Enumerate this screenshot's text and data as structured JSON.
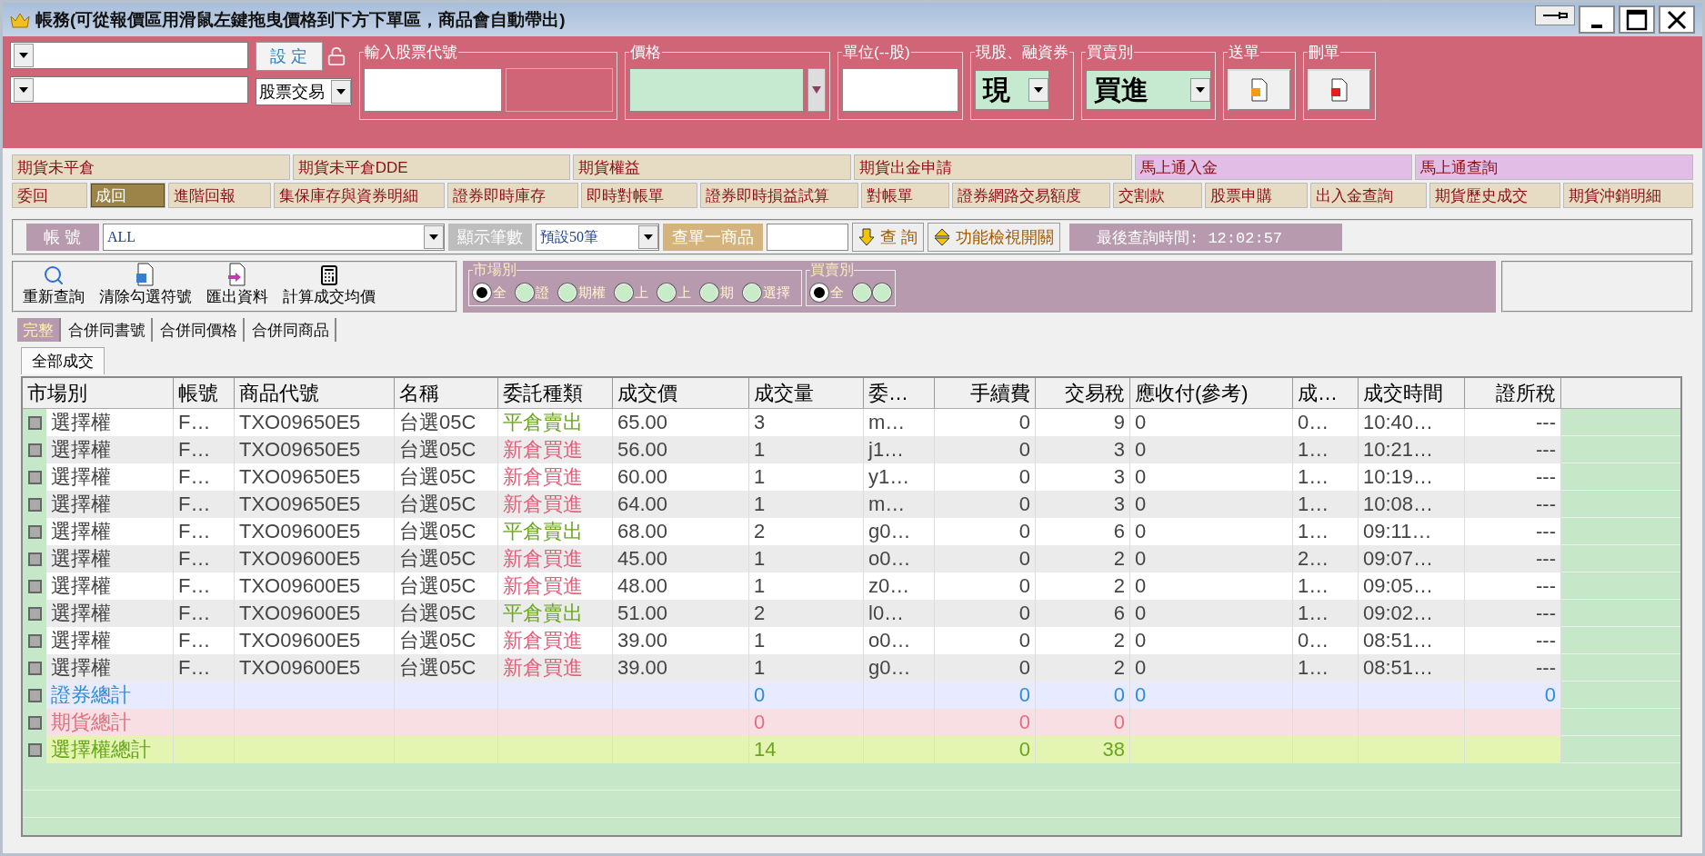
{
  "window": {
    "title": "帳務(可從報價區用滑鼠左鍵拖曳價格到下方下單區，商品會自動帶出)"
  },
  "order_panel": {
    "settings_button": "設 定",
    "trade_type": "股票交易",
    "stock_code_label": "輸入股票代號",
    "price_label": "價格",
    "unit_label": "單位(--股)",
    "cash_margin_label": "現股、融資券",
    "cash_margin": "現",
    "side_label": "買賣別",
    "side": "買進",
    "send_label": "送單",
    "delete_label": "刪單"
  },
  "tab_rows": [
    [
      {
        "label": "期貨未平倉",
        "color": "#e6dcc4",
        "selected": false
      },
      {
        "label": "期貨未平倉DDE",
        "color": "#e6dcc4",
        "selected": false
      },
      {
        "label": "期貨權益",
        "color": "#e6dcc4",
        "selected": false
      },
      {
        "label": "期貨出金申請",
        "color": "#e6dcc4",
        "selected": false
      },
      {
        "label": "馬上通入金",
        "color": "#e2bde6",
        "selected": false
      },
      {
        "label": "馬上通查詢",
        "color": "#e2bde6",
        "selected": false
      }
    ],
    [
      {
        "label": "委回",
        "color": "#e6dcc4",
        "selected": false
      },
      {
        "label": "成回",
        "color": "#9c8448",
        "selected": true
      },
      {
        "label": "進階回報",
        "color": "#e6dcc4",
        "selected": false
      },
      {
        "label": "集保庫存與資券明細",
        "color": "#e6dcc4",
        "selected": false
      },
      {
        "label": "證券即時庫存",
        "color": "#e6dcc4",
        "selected": false
      },
      {
        "label": "即時對帳單",
        "color": "#e6dcc4",
        "selected": false
      },
      {
        "label": "證券即時損益試算",
        "color": "#e6dcc4",
        "selected": false
      },
      {
        "label": "對帳單",
        "color": "#e6dcc4",
        "selected": false
      },
      {
        "label": "證券網路交易額度",
        "color": "#e6dcc4",
        "selected": false
      },
      {
        "label": "交割款",
        "color": "#e6dcc4",
        "selected": false
      },
      {
        "label": "股票申購",
        "color": "#e6dcc4",
        "selected": false
      },
      {
        "label": "出入金查詢",
        "color": "#e6dcc4",
        "selected": false
      },
      {
        "label": "期貨歷史成交",
        "color": "#e6dcc4",
        "selected": false
      },
      {
        "label": "期貨沖銷明細",
        "color": "#e6dcc4",
        "selected": false
      }
    ]
  ],
  "query_bar": {
    "account_label": "帳 號",
    "account": "ALL",
    "count_label": "顯示筆數",
    "count": "預設50筆",
    "product_label": "查單一商品",
    "query_button": "查 詢",
    "toggle_button": "功能檢視開關",
    "last_query": "最後查詢時間: 12:02:57"
  },
  "actions": [
    {
      "label": "重新查詢",
      "kind": "search"
    },
    {
      "label": "清除勾選符號",
      "kind": "clear"
    },
    {
      "label": "匯出資料",
      "kind": "export"
    },
    {
      "label": "計算成交均價",
      "kind": "calculator"
    }
  ],
  "market_filter": {
    "title": "市場別",
    "options": [
      {
        "label": "全",
        "selected": true
      },
      {
        "label": "證",
        "selected": false
      },
      {
        "label": "期權",
        "selected": false
      },
      {
        "label": "上",
        "selected": false
      },
      {
        "label": "上",
        "selected": false
      },
      {
        "label": "期",
        "selected": false
      },
      {
        "label": "選擇",
        "selected": false
      }
    ]
  },
  "side_filter": {
    "title": "買賣別",
    "options": [
      {
        "label": "全",
        "selected": true
      },
      {
        "selected": false
      },
      {
        "selected": false
      }
    ]
  },
  "view_tabs": [
    {
      "label": "完整",
      "selected": true
    },
    {
      "label": "合併同書號",
      "selected": false
    },
    {
      "label": "合併同價格",
      "selected": false
    },
    {
      "label": "合併同商品",
      "selected": false
    }
  ],
  "sub_tab": {
    "label": "全部成交"
  },
  "table": {
    "columns": [
      "市場別",
      "帳號",
      "商品代號",
      "名稱",
      "委託種類",
      "成交價",
      "成交量",
      "委…",
      "手續費",
      "交易稅",
      "應收付(參考)",
      "成…",
      "成交時間",
      "證所稅"
    ],
    "rows": [
      {
        "kind": "trade",
        "checked": false,
        "color": "#6aa51e",
        "cells": [
          "選擇權",
          "F…",
          "TXO09650E5",
          "台選05C",
          "平倉賣出",
          "65.00",
          "3",
          "m…",
          "0",
          "9",
          "0",
          "0…",
          "10:40…",
          "---"
        ]
      },
      {
        "kind": "trade",
        "checked": false,
        "color": "#e0607a",
        "cells": [
          "選擇權",
          "F…",
          "TXO09650E5",
          "台選05C",
          "新倉買進",
          "56.00",
          "1",
          "j1…",
          "0",
          "3",
          "0",
          "1…",
          "10:21…",
          "---"
        ]
      },
      {
        "kind": "trade",
        "checked": false,
        "color": "#e0607a",
        "cells": [
          "選擇權",
          "F…",
          "TXO09650E5",
          "台選05C",
          "新倉買進",
          "60.00",
          "1",
          "y1…",
          "0",
          "3",
          "0",
          "1…",
          "10:19…",
          "---"
        ]
      },
      {
        "kind": "trade",
        "checked": false,
        "color": "#e0607a",
        "cells": [
          "選擇權",
          "F…",
          "TXO09650E5",
          "台選05C",
          "新倉買進",
          "64.00",
          "1",
          "m…",
          "0",
          "3",
          "0",
          "1…",
          "10:08…",
          "---"
        ]
      },
      {
        "kind": "trade",
        "checked": false,
        "color": "#6aa51e",
        "cells": [
          "選擇權",
          "F…",
          "TXO09600E5",
          "台選05C",
          "平倉賣出",
          "68.00",
          "2",
          "g0…",
          "0",
          "6",
          "0",
          "1…",
          "09:11…",
          "---"
        ]
      },
      {
        "kind": "trade",
        "checked": false,
        "color": "#e0607a",
        "cells": [
          "選擇權",
          "F…",
          "TXO09600E5",
          "台選05C",
          "新倉買進",
          "45.00",
          "1",
          "o0…",
          "0",
          "2",
          "0",
          "2…",
          "09:07…",
          "---"
        ]
      },
      {
        "kind": "trade",
        "checked": false,
        "color": "#e0607a",
        "cells": [
          "選擇權",
          "F…",
          "TXO09600E5",
          "台選05C",
          "新倉買進",
          "48.00",
          "1",
          "z0…",
          "0",
          "2",
          "0",
          "1…",
          "09:05…",
          "---"
        ]
      },
      {
        "kind": "trade",
        "checked": false,
        "color": "#6aa51e",
        "cells": [
          "選擇權",
          "F…",
          "TXO09600E5",
          "台選05C",
          "平倉賣出",
          "51.00",
          "2",
          "l0…",
          "0",
          "6",
          "0",
          "1…",
          "09:02…",
          "---"
        ]
      },
      {
        "kind": "trade",
        "checked": false,
        "color": "#e0607a",
        "cells": [
          "選擇權",
          "F…",
          "TXO09600E5",
          "台選05C",
          "新倉買進",
          "39.00",
          "1",
          "o0…",
          "0",
          "2",
          "0",
          "0…",
          "08:51…",
          "---"
        ]
      },
      {
        "kind": "trade",
        "checked": false,
        "color": "#e0607a",
        "cells": [
          "選擇權",
          "F…",
          "TXO09600E5",
          "台選05C",
          "新倉買進",
          "39.00",
          "1",
          "g0…",
          "0",
          "2",
          "0",
          "1…",
          "08:51…",
          "---"
        ]
      },
      {
        "kind": "stock_total",
        "checked": false,
        "color": "#2a8fd8",
        "cells": [
          "證券總計",
          null,
          null,
          null,
          null,
          null,
          "0",
          null,
          "0",
          "0",
          "0",
          null,
          null,
          "0"
        ]
      },
      {
        "kind": "futures_total",
        "checked": false,
        "color": "#e0707f",
        "cells": [
          "期貨總計",
          null,
          null,
          null,
          null,
          null,
          "0",
          null,
          "0",
          "0",
          null,
          null,
          null,
          null
        ]
      },
      {
        "kind": "option_total",
        "checked": false,
        "color": "#6aa51e",
        "cells": [
          "選擇權總計",
          null,
          null,
          null,
          null,
          null,
          "14",
          null,
          "0",
          "38",
          null,
          null,
          null,
          null
        ]
      }
    ]
  }
}
